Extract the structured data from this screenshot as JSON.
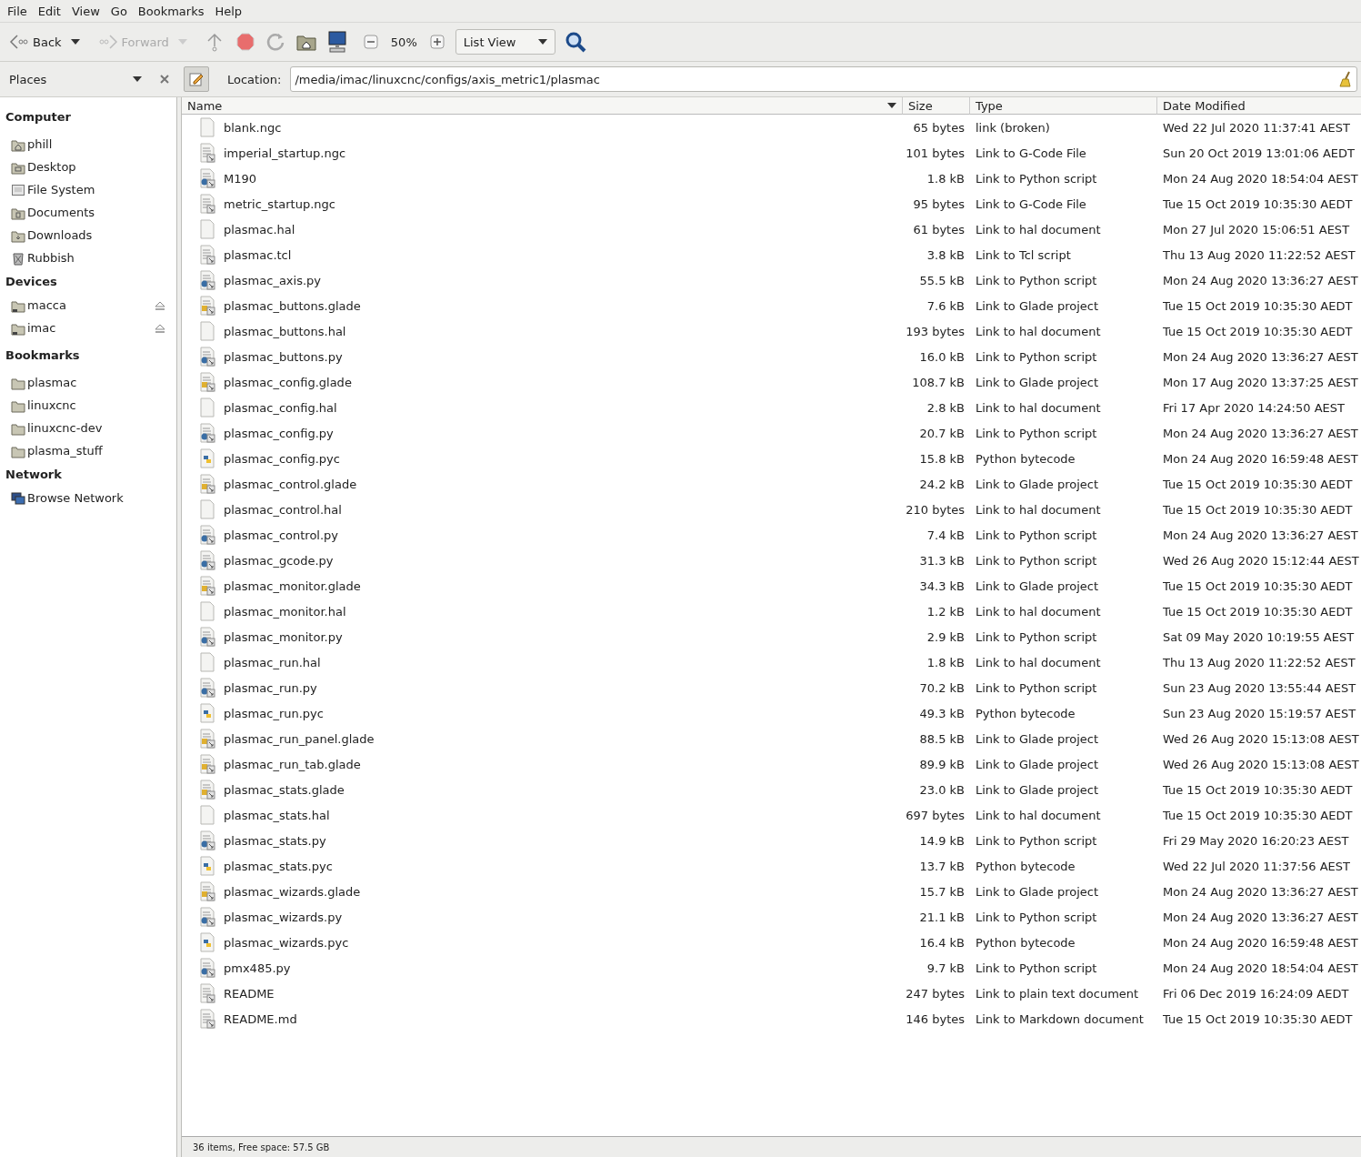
{
  "menu": [
    "File",
    "Edit",
    "View",
    "Go",
    "Bookmarks",
    "Help"
  ],
  "toolbar": {
    "back": {
      "label": "Back",
      "disabled": false
    },
    "forward": {
      "label": "Forward",
      "disabled": true
    },
    "zoom": "50%",
    "view": "List View"
  },
  "sidebar": {
    "title": "Places",
    "sections": [
      {
        "title": "Computer",
        "items": [
          {
            "label": "phill",
            "kind": "home"
          },
          {
            "label": "Desktop",
            "kind": "desktop"
          },
          {
            "label": "File System",
            "kind": "drive"
          },
          {
            "label": "Documents",
            "kind": "documents"
          },
          {
            "label": "Downloads",
            "kind": "downloads"
          },
          {
            "label": "Rubbish",
            "kind": "trash"
          }
        ]
      },
      {
        "title": "Devices",
        "items": [
          {
            "label": "macca",
            "kind": "device",
            "eject": true
          },
          {
            "label": "imac",
            "kind": "device",
            "eject": true
          }
        ]
      },
      {
        "title": "Bookmarks",
        "items": [
          {
            "label": "plasmac",
            "kind": "folder"
          },
          {
            "label": "linuxcnc",
            "kind": "folder"
          },
          {
            "label": "linuxcnc-dev",
            "kind": "folder"
          },
          {
            "label": "plasma_stuff",
            "kind": "folder"
          }
        ]
      },
      {
        "title": "Network",
        "items": [
          {
            "label": "Browse Network",
            "kind": "network"
          }
        ]
      }
    ]
  },
  "location": {
    "label": "Location:",
    "value": "/media/imac/linuxcnc/configs/axis_metric1/plasmac"
  },
  "table": {
    "columns": [
      {
        "label": "Name",
        "sorted": true
      },
      {
        "label": "Size",
        "sorted": false
      },
      {
        "label": "Type",
        "sorted": false
      },
      {
        "label": "Date Modified",
        "sorted": false
      }
    ],
    "rows": [
      {
        "name": "blank.ngc",
        "size": "65 bytes",
        "type": "link (broken)",
        "date": "Wed 22 Jul 2020 11:37:41 AEST",
        "kind": "blank"
      },
      {
        "name": "imperial_startup.ngc",
        "size": "101 bytes",
        "type": "Link to G-Code File",
        "date": "Sun 20 Oct 2019 13:01:06 AEDT",
        "kind": "text"
      },
      {
        "name": "M190",
        "size": "1.8 kB",
        "type": "Link to Python script",
        "date": "Mon 24 Aug 2020 18:54:04 AEST",
        "kind": "python"
      },
      {
        "name": "metric_startup.ngc",
        "size": "95 bytes",
        "type": "Link to G-Code File",
        "date": "Tue 15 Oct 2019 10:35:30 AEDT",
        "kind": "text"
      },
      {
        "name": "plasmac.hal",
        "size": "61 bytes",
        "type": "Link to hal document",
        "date": "Mon 27 Jul 2020 15:06:51 AEST",
        "kind": "blank"
      },
      {
        "name": "plasmac.tcl",
        "size": "3.8 kB",
        "type": "Link to Tcl script",
        "date": "Thu 13 Aug 2020 11:22:52 AEST",
        "kind": "text"
      },
      {
        "name": "plasmac_axis.py",
        "size": "55.5 kB",
        "type": "Link to Python script",
        "date": "Mon 24 Aug 2020 13:36:27 AEST",
        "kind": "python"
      },
      {
        "name": "plasmac_buttons.glade",
        "size": "7.6 kB",
        "type": "Link to Glade project",
        "date": "Tue 15 Oct 2019 10:35:30 AEDT",
        "kind": "glade"
      },
      {
        "name": "plasmac_buttons.hal",
        "size": "193 bytes",
        "type": "Link to hal document",
        "date": "Tue 15 Oct 2019 10:35:30 AEDT",
        "kind": "blank"
      },
      {
        "name": "plasmac_buttons.py",
        "size": "16.0 kB",
        "type": "Link to Python script",
        "date": "Mon 24 Aug 2020 13:36:27 AEST",
        "kind": "python"
      },
      {
        "name": "plasmac_config.glade",
        "size": "108.7 kB",
        "type": "Link to Glade project",
        "date": "Mon 17 Aug 2020 13:37:25 AEST",
        "kind": "glade"
      },
      {
        "name": "plasmac_config.hal",
        "size": "2.8 kB",
        "type": "Link to hal document",
        "date": "Fri 17 Apr 2020 14:24:50 AEST",
        "kind": "blank"
      },
      {
        "name": "plasmac_config.py",
        "size": "20.7 kB",
        "type": "Link to Python script",
        "date": "Mon 24 Aug 2020 13:36:27 AEST",
        "kind": "python"
      },
      {
        "name": "plasmac_config.pyc",
        "size": "15.8 kB",
        "type": "Python bytecode",
        "date": "Mon 24 Aug 2020 16:59:48 AEST",
        "kind": "bytecode"
      },
      {
        "name": "plasmac_control.glade",
        "size": "24.2 kB",
        "type": "Link to Glade project",
        "date": "Tue 15 Oct 2019 10:35:30 AEDT",
        "kind": "glade"
      },
      {
        "name": "plasmac_control.hal",
        "size": "210 bytes",
        "type": "Link to hal document",
        "date": "Tue 15 Oct 2019 10:35:30 AEDT",
        "kind": "blank"
      },
      {
        "name": "plasmac_control.py",
        "size": "7.4 kB",
        "type": "Link to Python script",
        "date": "Mon 24 Aug 2020 13:36:27 AEST",
        "kind": "python"
      },
      {
        "name": "plasmac_gcode.py",
        "size": "31.3 kB",
        "type": "Link to Python script",
        "date": "Wed 26 Aug 2020 15:12:44 AEST",
        "kind": "python"
      },
      {
        "name": "plasmac_monitor.glade",
        "size": "34.3 kB",
        "type": "Link to Glade project",
        "date": "Tue 15 Oct 2019 10:35:30 AEDT",
        "kind": "glade"
      },
      {
        "name": "plasmac_monitor.hal",
        "size": "1.2 kB",
        "type": "Link to hal document",
        "date": "Tue 15 Oct 2019 10:35:30 AEDT",
        "kind": "blank"
      },
      {
        "name": "plasmac_monitor.py",
        "size": "2.9 kB",
        "type": "Link to Python script",
        "date": "Sat 09 May 2020 10:19:55 AEST",
        "kind": "python"
      },
      {
        "name": "plasmac_run.hal",
        "size": "1.8 kB",
        "type": "Link to hal document",
        "date": "Thu 13 Aug 2020 11:22:52 AEST",
        "kind": "blank"
      },
      {
        "name": "plasmac_run.py",
        "size": "70.2 kB",
        "type": "Link to Python script",
        "date": "Sun 23 Aug 2020 13:55:44 AEST",
        "kind": "python"
      },
      {
        "name": "plasmac_run.pyc",
        "size": "49.3 kB",
        "type": "Python bytecode",
        "date": "Sun 23 Aug 2020 15:19:57 AEST",
        "kind": "bytecode"
      },
      {
        "name": "plasmac_run_panel.glade",
        "size": "88.5 kB",
        "type": "Link to Glade project",
        "date": "Wed 26 Aug 2020 15:13:08 AEST",
        "kind": "glade"
      },
      {
        "name": "plasmac_run_tab.glade",
        "size": "89.9 kB",
        "type": "Link to Glade project",
        "date": "Wed 26 Aug 2020 15:13:08 AEST",
        "kind": "glade"
      },
      {
        "name": "plasmac_stats.glade",
        "size": "23.0 kB",
        "type": "Link to Glade project",
        "date": "Tue 15 Oct 2019 10:35:30 AEDT",
        "kind": "glade"
      },
      {
        "name": "plasmac_stats.hal",
        "size": "697 bytes",
        "type": "Link to hal document",
        "date": "Tue 15 Oct 2019 10:35:30 AEDT",
        "kind": "blank"
      },
      {
        "name": "plasmac_stats.py",
        "size": "14.9 kB",
        "type": "Link to Python script",
        "date": "Fri 29 May 2020 16:20:23 AEST",
        "kind": "python"
      },
      {
        "name": "plasmac_stats.pyc",
        "size": "13.7 kB",
        "type": "Python bytecode",
        "date": "Wed 22 Jul 2020 11:37:56 AEST",
        "kind": "bytecode"
      },
      {
        "name": "plasmac_wizards.glade",
        "size": "15.7 kB",
        "type": "Link to Glade project",
        "date": "Mon 24 Aug 2020 13:36:27 AEST",
        "kind": "glade"
      },
      {
        "name": "plasmac_wizards.py",
        "size": "21.1 kB",
        "type": "Link to Python script",
        "date": "Mon 24 Aug 2020 13:36:27 AEST",
        "kind": "python"
      },
      {
        "name": "plasmac_wizards.pyc",
        "size": "16.4 kB",
        "type": "Python bytecode",
        "date": "Mon 24 Aug 2020 16:59:48 AEST",
        "kind": "bytecode"
      },
      {
        "name": "pmx485.py",
        "size": "9.7 kB",
        "type": "Link to Python script",
        "date": "Mon 24 Aug 2020 18:54:04 AEST",
        "kind": "python"
      },
      {
        "name": "README",
        "size": "247 bytes",
        "type": "Link to plain text document",
        "date": "Fri 06 Dec 2019 16:24:09 AEDT",
        "kind": "text"
      },
      {
        "name": "README.md",
        "size": "146 bytes",
        "type": "Link to Markdown document",
        "date": "Tue 15 Oct 2019 10:35:30 AEDT",
        "kind": "text"
      }
    ]
  },
  "status_bar": "36 items, Free space: 57.5 GB"
}
